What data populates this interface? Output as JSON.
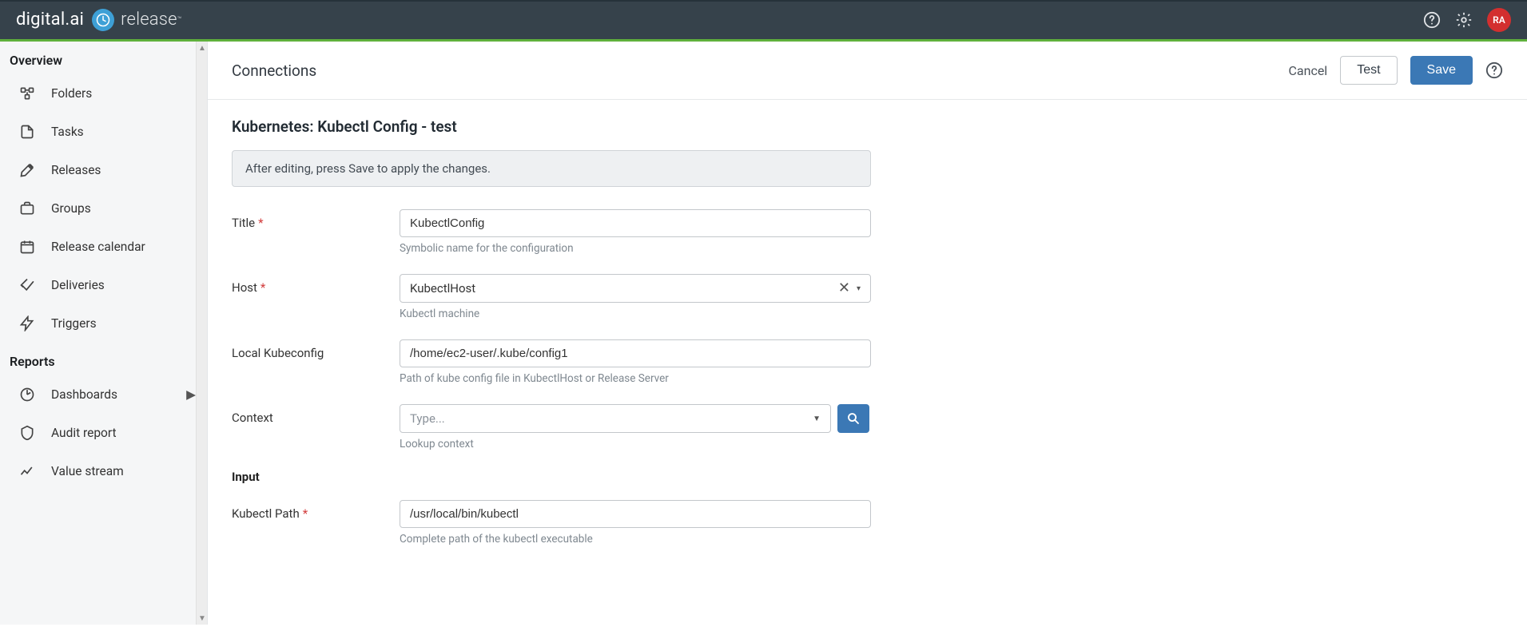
{
  "brand": {
    "name": "digital.ai",
    "product": "release",
    "tm": "™"
  },
  "user": {
    "initials": "RA"
  },
  "sidebar": {
    "section_overview": "Overview",
    "section_reports": "Reports",
    "items": [
      {
        "label": "Folders"
      },
      {
        "label": "Tasks"
      },
      {
        "label": "Releases"
      },
      {
        "label": "Groups"
      },
      {
        "label": "Release calendar"
      },
      {
        "label": "Deliveries"
      },
      {
        "label": "Triggers"
      }
    ],
    "report_items": [
      {
        "label": "Dashboards"
      },
      {
        "label": "Audit report"
      },
      {
        "label": "Value stream"
      }
    ]
  },
  "page": {
    "title": "Connections",
    "actions": {
      "cancel": "Cancel",
      "test": "Test",
      "save": "Save"
    },
    "subtitle": "Kubernetes: Kubectl Config - test",
    "banner": "After editing, press Save to apply the changes."
  },
  "form": {
    "title": {
      "label": "Title",
      "value": "KubectlConfig",
      "help": "Symbolic name for the configuration",
      "required": true
    },
    "host": {
      "label": "Host",
      "value": "KubectlHost",
      "help": "Kubectl machine",
      "required": true
    },
    "local_kubeconfig": {
      "label": "Local Kubeconfig",
      "value": "/home/ec2-user/.kube/config1",
      "help": "Path of kube config file in KubectlHost or Release Server",
      "required": false
    },
    "context": {
      "label": "Context",
      "placeholder": "Type...",
      "help": "Lookup context",
      "required": false
    },
    "input_section": "Input",
    "kubectl_path": {
      "label": "Kubectl Path",
      "value": "/usr/local/bin/kubectl",
      "help": "Complete path of the kubectl executable",
      "required": true
    }
  }
}
